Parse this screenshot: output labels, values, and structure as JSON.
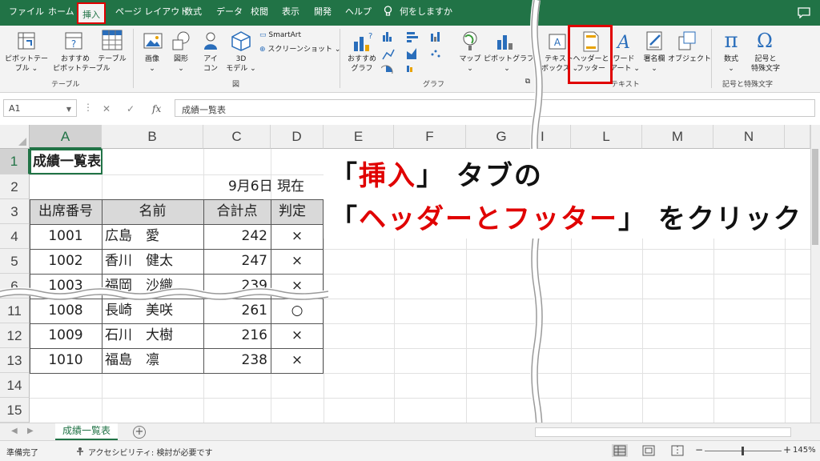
{
  "menu": {
    "items": [
      "ファイル",
      "ホーム",
      "挿入",
      "ページ レイアウト",
      "数式",
      "データ",
      "校閲",
      "表示",
      "開発",
      "ヘルプ"
    ],
    "tell_me": "何をしますか"
  },
  "ribbon": {
    "groups": {
      "table": "テーブル",
      "illustrations": "図",
      "charts": "グラフ",
      "text": "テキスト",
      "symbols": "記号と特殊文字"
    },
    "buttons": {
      "pivot_table": [
        "ピボットテー",
        "ブル ⌄"
      ],
      "recommended_pivot": [
        "おすすめ",
        "ピボットテーブル"
      ],
      "table": [
        "テーブル"
      ],
      "images": [
        "画像",
        "⌄"
      ],
      "shapes": [
        "図形",
        "⌄"
      ],
      "icons": [
        "アイ",
        "コン"
      ],
      "models_3d": [
        "3D",
        "モデル ⌄"
      ],
      "smartart": "SmartArt",
      "screenshot": "スクリーンショット ⌄",
      "recommended_charts": [
        "おすすめ",
        "グラフ"
      ],
      "maps": [
        "マップ",
        "⌄"
      ],
      "pivot_chart": [
        "ピボットグラフ",
        "⌄"
      ],
      "text_box": [
        "テキスト",
        "ボックス ⌄"
      ],
      "header_footer": [
        "ヘッダーと",
        "フッター"
      ],
      "wordart": [
        "ワード",
        "アート ⌄"
      ],
      "signature": [
        "署名欄",
        "⌄"
      ],
      "object": [
        "オブジェクト"
      ],
      "equation": [
        "数式",
        "⌄"
      ],
      "symbol": [
        "記号と",
        "特殊文字"
      ]
    }
  },
  "formula_bar": {
    "name_box": "A1",
    "fx": "fx",
    "content": "成績一覧表"
  },
  "columns": [
    "A",
    "B",
    "C",
    "D",
    "E",
    "F",
    "G",
    "I",
    "L",
    "M",
    "N"
  ],
  "rows": [
    "1",
    "2",
    "3",
    "4",
    "5",
    "6",
    "11",
    "12",
    "13",
    "14",
    "15"
  ],
  "sheet": {
    "title": "成績一覧表",
    "date": "9月6日 現在",
    "headers": [
      "出席番号",
      "名前",
      "合計点",
      "判定"
    ],
    "records": [
      {
        "no": "1001",
        "name": "広島　愛",
        "total": "242",
        "mark": "×"
      },
      {
        "no": "1002",
        "name": "香川　健太",
        "total": "247",
        "mark": "×"
      },
      {
        "no": "1003",
        "name": "福岡　沙織",
        "total": "239",
        "mark": "×"
      },
      {
        "no": "1008",
        "name": "長崎　美咲",
        "total": "261",
        "mark": "○"
      },
      {
        "no": "1009",
        "name": "石川　大樹",
        "total": "216",
        "mark": "×"
      },
      {
        "no": "1010",
        "name": "福島　凛",
        "total": "238",
        "mark": "×"
      }
    ]
  },
  "callout": {
    "line1": [
      "「",
      "挿入",
      "」 タブの"
    ],
    "line2": [
      "「",
      "ヘッダーとフッター",
      "」 をクリック"
    ]
  },
  "sheet_tab": "成績一覧表",
  "add_sheet": "+",
  "status": {
    "ready": "準備完了",
    "accessibility": "アクセシビリティ: 検討が必要です",
    "zoom": "145%",
    "zoom_minus": "−",
    "zoom_plus": "+"
  },
  "colors": {
    "excel_green": "#217346",
    "highlight_red": "#e00000"
  },
  "icons": [
    "lightbulb-icon",
    "comment-icon",
    "pivot-table-icon",
    "image-icon",
    "shapes-icon",
    "3d-model-icon",
    "chart-icon",
    "map-icon",
    "header-footer-icon",
    "wordart-icon",
    "signature-icon",
    "object-icon",
    "pi-icon",
    "omega-icon"
  ]
}
